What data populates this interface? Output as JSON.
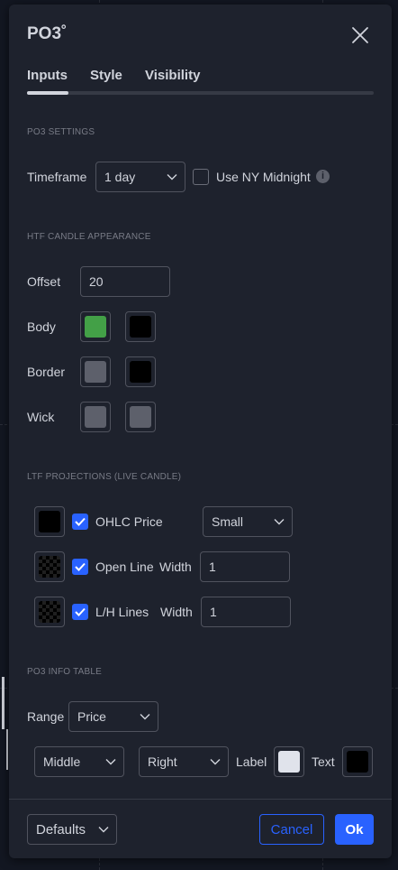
{
  "dialog": {
    "title": "PO3˚",
    "tabs": [
      {
        "label": "Inputs",
        "active": true
      },
      {
        "label": "Style",
        "active": false
      },
      {
        "label": "Visibility",
        "active": false
      }
    ]
  },
  "po3_settings": {
    "section_label": "PO3 SETTINGS",
    "timeframe_label": "Timeframe",
    "timeframe_value": "1 day",
    "ny_midnight_label": "Use NY Midnight",
    "ny_midnight_checked": false,
    "info_glyph": "i"
  },
  "htf_candle": {
    "section_label": "HTF CANDLE APPEARANCE",
    "offset_label": "Offset",
    "offset_value": "20",
    "body_label": "Body",
    "body_colors": [
      "#43a047",
      "#000000"
    ],
    "border_label": "Border",
    "border_colors": [
      "#5d606b",
      "#000000"
    ],
    "wick_label": "Wick",
    "wick_colors": [
      "#5d606b",
      "#5d606b"
    ]
  },
  "ltf_projections": {
    "section_label": "LTF PROJECTIONS (LIVE CANDLE)",
    "ohlc_label": "OHLC Price",
    "ohlc_checked": true,
    "ohlc_color": "#000000",
    "ohlc_size": "Small",
    "open_line_label": "Open Line",
    "open_line_checked": true,
    "open_line_width_label": "Width",
    "open_line_width": "1",
    "lh_lines_label": "L/H Lines",
    "lh_lines_checked": true,
    "lh_lines_width_label": "Width",
    "lh_lines_width": "1"
  },
  "info_table": {
    "section_label": "PO3 INFO TABLE",
    "range_label": "Range",
    "range_value": "Price",
    "vertical_position": "Middle",
    "horizontal_position": "Right",
    "label_label": "Label",
    "label_color": "#e0e3eb",
    "text_label": "Text",
    "text_color": "#000000"
  },
  "footer": {
    "defaults_label": "Defaults",
    "cancel_label": "Cancel",
    "ok_label": "Ok"
  },
  "colors": {
    "accent": "#2962ff",
    "dialog_bg": "#1e222d",
    "text": "#d1d4dc",
    "muted": "#787b86"
  }
}
